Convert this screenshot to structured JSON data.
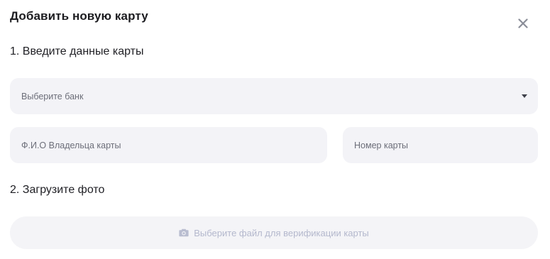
{
  "modal": {
    "title": "Добавить новую карту",
    "close_icon": "close-icon"
  },
  "step1": {
    "label": "1. Введите данные карты",
    "bank_select": {
      "placeholder": "Выберите банк",
      "icon": "caret-down-icon"
    },
    "owner_field": {
      "placeholder": "Ф.И.О Владельца карты"
    },
    "card_number_field": {
      "placeholder": "Номер карты"
    }
  },
  "step2": {
    "label": "2. Загрузите фото",
    "upload_button": {
      "label": "Выберите файл для верификации карты",
      "icon": "camera-icon"
    }
  },
  "colors": {
    "field_background": "#f3f3f7",
    "placeholder_text": "#6c6e79",
    "upload_text": "#b4b8cd",
    "close_icon": "#8a8d98"
  }
}
